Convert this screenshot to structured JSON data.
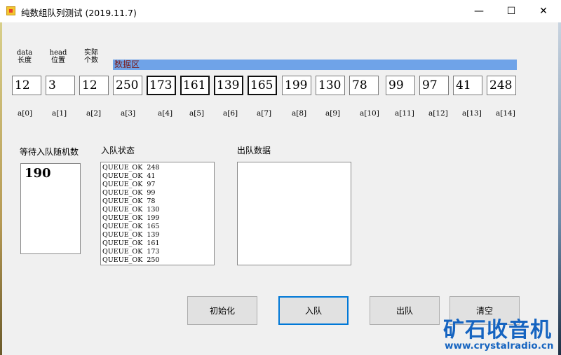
{
  "window": {
    "title": "纯数组队列测试 (2019.11.7)",
    "minimize_glyph": "—",
    "maximize_glyph": "☐",
    "close_glyph": "✕"
  },
  "labels": {
    "data_len_1": "data",
    "data_len_2": "长度",
    "head_pos_1": "head",
    "head_pos_2": "位置",
    "actual_1": "实际",
    "actual_2": "个数",
    "data_area": "数据区"
  },
  "values": {
    "data_length": "12",
    "head_position": "3",
    "actual_count": "12",
    "cells": [
      "250",
      "173",
      "161",
      "139",
      "165",
      "199",
      "130",
      "78",
      "99",
      "97",
      "41",
      "248"
    ]
  },
  "indices": [
    "a[0]",
    "a[1]",
    "a[2]",
    "a[3]",
    "a[4]",
    "a[5]",
    "a[6]",
    "a[7]",
    "a[8]",
    "a[9]",
    "a[10]",
    "a[11]",
    "a[12]",
    "a[13]",
    "a[14]"
  ],
  "sections": {
    "waiting": "等待入队随机数",
    "enqueue_status": "入队状态",
    "dequeue_data": "出队数据"
  },
  "waiting_value": "190",
  "enqueue_log": [
    "QUEUE_OK  248",
    "QUEUE_OK  41",
    "QUEUE_OK  97",
    "QUEUE_OK  99",
    "QUEUE_OK  78",
    "QUEUE_OK  130",
    "QUEUE_OK  199",
    "QUEUE_OK  165",
    "QUEUE_OK  139",
    "QUEUE_OK  161",
    "QUEUE_OK  173",
    "QUEUE_OK  250"
  ],
  "buttons": {
    "init": "初始化",
    "enqueue": "入队",
    "dequeue": "出队",
    "clear": "清空"
  },
  "watermark": {
    "brand": "矿石收音机",
    "url": "www.crystalradio.cn"
  },
  "colors": {
    "data_area_bg": "#6fa3e8",
    "data_area_text": "#7a1c1c",
    "focus": "#0078d7",
    "watermark": "#1664c0"
  }
}
